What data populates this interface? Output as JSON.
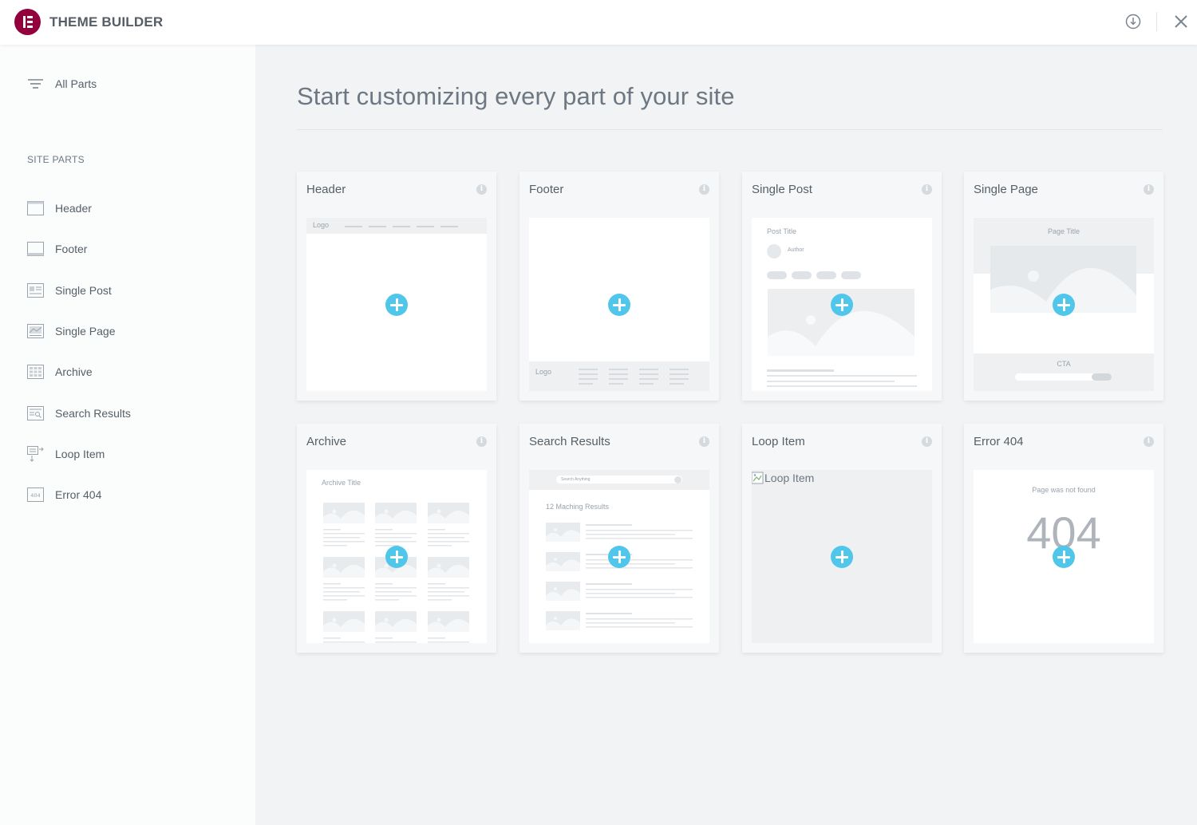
{
  "header": {
    "app_title": "THEME BUILDER",
    "actions": [
      {
        "name": "download-icon"
      },
      {
        "name": "close-icon"
      }
    ]
  },
  "sidebar": {
    "all_parts_label": "All Parts",
    "section_heading": "SITE PARTS",
    "items": [
      {
        "label": "Header",
        "icon": "header-icon"
      },
      {
        "label": "Footer",
        "icon": "footer-icon"
      },
      {
        "label": "Single Post",
        "icon": "single-post-icon"
      },
      {
        "label": "Single Page",
        "icon": "single-page-icon"
      },
      {
        "label": "Archive",
        "icon": "archive-icon"
      },
      {
        "label": "Search Results",
        "icon": "search-results-icon"
      },
      {
        "label": "Loop Item",
        "icon": "loop-item-icon"
      },
      {
        "label": "Error 404",
        "icon": "error-404-icon"
      }
    ]
  },
  "main": {
    "title": "Start customizing every part of your site",
    "cards": [
      {
        "title": "Header",
        "preview": {
          "logo": "Logo"
        }
      },
      {
        "title": "Footer",
        "preview": {
          "logo": "Logo"
        }
      },
      {
        "title": "Single Post",
        "preview": {
          "post_title": "Post Title",
          "author": "Author"
        }
      },
      {
        "title": "Single Page",
        "preview": {
          "page_title": "Page Title",
          "cta": "CTA"
        }
      },
      {
        "title": "Archive",
        "preview": {
          "archive_title": "Archive Title"
        }
      },
      {
        "title": "Search Results",
        "preview": {
          "search_placeholder": "Search Anything",
          "results_count": "12 Maching Results"
        }
      },
      {
        "title": "Loop Item",
        "preview": {
          "broken_image_alt": "Loop Item"
        }
      },
      {
        "title": "Error 404",
        "preview": {
          "message": "Page was not found",
          "code": "404"
        }
      }
    ]
  },
  "colors": {
    "brand": "#93003c",
    "accent": "#4fc6ea",
    "sidebar_bg": "#fbfcfc",
    "main_bg": "#f1f3f5"
  }
}
